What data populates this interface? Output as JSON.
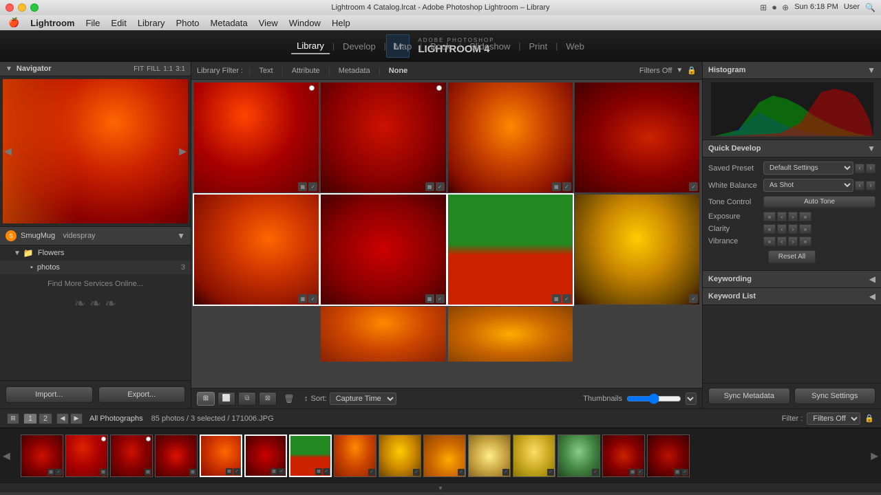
{
  "titlebar": {
    "title": "Lightroom 4 Catalog.lrcat - Adobe Photoshop Lightroom – Library"
  },
  "menubar": {
    "apple": "🍎",
    "items": [
      "Lightroom",
      "File",
      "Edit",
      "Library",
      "Photo",
      "Metadata",
      "View",
      "Window",
      "Help"
    ]
  },
  "top_nav": {
    "logo_text": "Lr",
    "adobe_text": "ADOBE PHOTOSHOP",
    "lr_name": "LIGHTROOM 4",
    "modules": [
      "Library",
      "Develop",
      "Map",
      "Book",
      "Slideshow",
      "Print",
      "Web"
    ],
    "active_module": "Library",
    "separator": "|"
  },
  "left_panel": {
    "navigator": {
      "label": "Navigator",
      "controls": [
        "FIT",
        "FILL",
        "1:1",
        "3:1"
      ]
    },
    "smugmug": {
      "label": "SmugMug",
      "username": "videspray",
      "folders": [
        {
          "name": "Flowers",
          "type": "folder"
        }
      ],
      "subfolders": [
        {
          "name": "photos",
          "count": "3"
        }
      ],
      "find_more": "Find More Services Online..."
    },
    "buttons": {
      "import": "Import...",
      "export": "Export..."
    }
  },
  "filter_bar": {
    "label": "Library Filter :",
    "options": [
      "Text",
      "Attribute",
      "Metadata",
      "None"
    ],
    "active": "None",
    "filters_off": "Filters Off"
  },
  "toolbar": {
    "sort_label": "Sort:",
    "sort_value": "Capture Time",
    "thumbnails_label": "Thumbnails"
  },
  "statusbar": {
    "pages": [
      "1",
      "2"
    ],
    "all_photos": "All Photographs",
    "photo_count": "85 photos / 3 selected / 171006.JPG",
    "filter_label": "Filter :",
    "filter_value": "Filters Off"
  },
  "right_panel": {
    "histogram": {
      "label": "Histogram"
    },
    "quick_develop": {
      "label": "Quick Develop",
      "saved_preset": {
        "label": "Saved Preset",
        "value": "Default Settings"
      },
      "white_balance": {
        "label": "White Balance",
        "value": "As Shot"
      },
      "tone_control": {
        "label": "Tone Control",
        "value": "Auto Tone"
      },
      "exposure": {
        "label": "Exposure"
      },
      "clarity": {
        "label": "Clarity"
      },
      "vibrance": {
        "label": "Vibrance"
      },
      "reset_btn": "Reset All"
    },
    "keywording": {
      "label": "Keywording"
    },
    "keyword_list": {
      "label": "Keyword List"
    },
    "sync_buttons": {
      "metadata": "Sync Metadata",
      "settings": "Sync Settings"
    }
  },
  "grid": {
    "rows": [
      [
        {
          "type": "photo-red2",
          "selected": false,
          "dot": true
        },
        {
          "type": "photo-red",
          "selected": false,
          "dot": true
        },
        {
          "type": "photo-orange",
          "selected": false,
          "dot": false
        },
        {
          "type": "photo-red",
          "selected": false,
          "dot": false
        }
      ],
      [
        {
          "type": "photo-leaf",
          "selected": true,
          "dot": false
        },
        {
          "type": "photo-red",
          "selected": true,
          "dot": false
        },
        {
          "type": "photo-green-red",
          "selected": true,
          "dot": false
        },
        {
          "type": "photo-gold",
          "selected": false,
          "dot": false
        }
      ],
      [
        {
          "type": "empty",
          "selected": false
        },
        {
          "type": "photo-orange",
          "selected": false
        },
        {
          "type": "photo-orange",
          "selected": false
        },
        {
          "type": "empty",
          "selected": false
        }
      ]
    ]
  },
  "filmstrip": {
    "thumbs": [
      {
        "type": "photo-red",
        "selected": false
      },
      {
        "type": "photo-red2",
        "selected": false
      },
      {
        "type": "photo-red",
        "selected": false
      },
      {
        "type": "photo-red",
        "selected": false
      },
      {
        "type": "photo-leaf",
        "selected": true
      },
      {
        "type": "photo-red",
        "selected": true
      },
      {
        "type": "photo-green-red",
        "selected": true
      },
      {
        "type": "photo-orange",
        "selected": false
      },
      {
        "type": "photo-gold",
        "selected": false
      },
      {
        "type": "photo-gold",
        "selected": false
      },
      {
        "type": "photo-orange",
        "selected": false
      },
      {
        "type": "photo-gold",
        "selected": false
      },
      {
        "type": "photo-gold",
        "selected": false
      },
      {
        "type": "photo-green",
        "selected": false
      },
      {
        "type": "photo-red2",
        "selected": false
      },
      {
        "type": "photo-red",
        "selected": false
      },
      {
        "type": "photo-red2",
        "selected": false
      }
    ]
  }
}
